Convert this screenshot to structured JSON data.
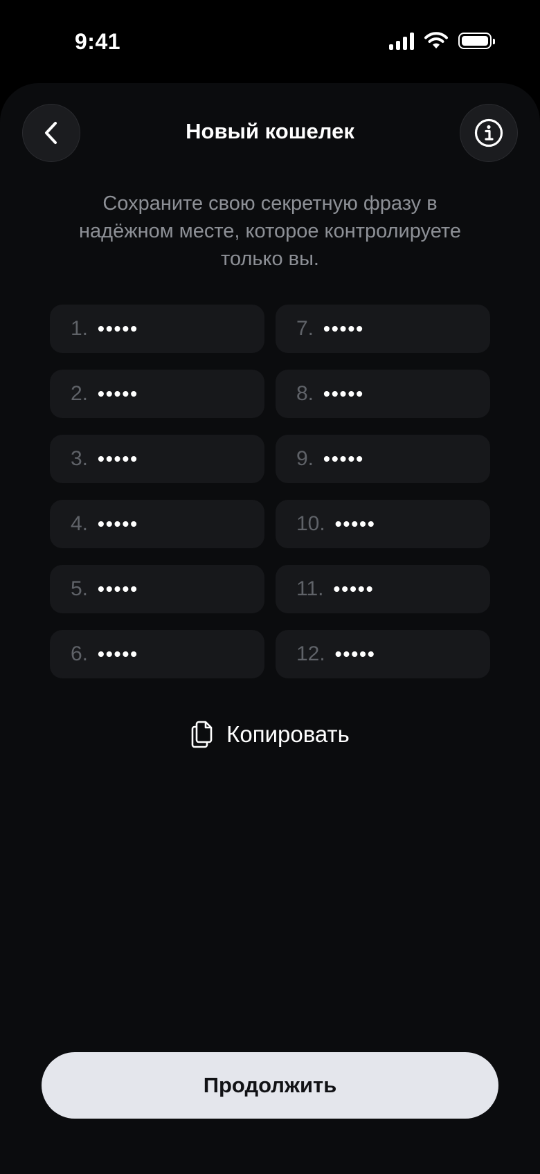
{
  "status_bar": {
    "time": "9:41",
    "icons": [
      "signal-icon",
      "wifi-icon",
      "battery-icon"
    ]
  },
  "header": {
    "title": "Новый кошелек",
    "back_icon": "chevron-left-icon",
    "info_icon": "info-icon"
  },
  "subtitle": "Сохраните свою секретную фразу в надёжном месте, которое контролируете только вы.",
  "seed_words": [
    {
      "number": "1.",
      "mask": "•••••"
    },
    {
      "number": "7.",
      "mask": "•••••"
    },
    {
      "number": "2.",
      "mask": "•••••"
    },
    {
      "number": "8.",
      "mask": "•••••"
    },
    {
      "number": "3.",
      "mask": "•••••"
    },
    {
      "number": "9.",
      "mask": "•••••"
    },
    {
      "number": "4.",
      "mask": "•••••"
    },
    {
      "number": "10.",
      "mask": "•••••"
    },
    {
      "number": "5.",
      "mask": "•••••"
    },
    {
      "number": "11.",
      "mask": "•••••"
    },
    {
      "number": "6.",
      "mask": "•••••"
    },
    {
      "number": "12.",
      "mask": "•••••"
    }
  ],
  "copy": {
    "label": "Копировать",
    "icon": "copy-icon"
  },
  "continue_button": {
    "label": "Продолжить"
  },
  "colors": {
    "background": "#000000",
    "sheet": "#0b0c0e",
    "cell": "#17181b",
    "button": "#e4e6ec",
    "muted_text": "#8d9096"
  }
}
